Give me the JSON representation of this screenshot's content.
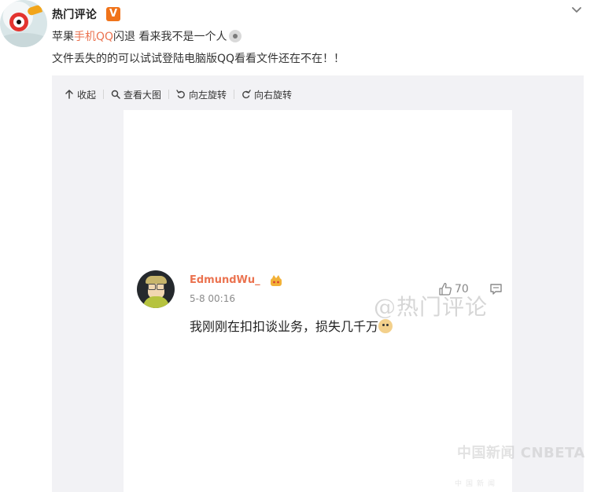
{
  "post": {
    "author": "热门评论",
    "verified_badge": "V",
    "line1_prefix": "苹果",
    "line1_highlight": "手机QQ",
    "line1_suffix": "闪退 看来我不是一个人",
    "line2": "文件丢失的的可以试试登陆电脑版QQ看看文件还在不在！！"
  },
  "toolbar": {
    "collapse": "收起",
    "view_large": "查看大图",
    "rotate_left": "向左旋转",
    "rotate_right": "向右旋转"
  },
  "comment": {
    "username": "EdmundWu_",
    "time": "5-8 00:16",
    "text": "我刚刚在扣扣谈业务，损失几千万",
    "likes": "70"
  },
  "watermark": "@热门评论",
  "brand": {
    "main": "中国新闻 CNBETA",
    "sub": "中国新闻"
  },
  "colors": {
    "accent": "#eb7350",
    "verified": "#f0731a",
    "panel_bg": "#f2f2f5"
  },
  "icons": {
    "collapse": "up-arrow-icon",
    "view_large": "search-icon",
    "rotate_left": "rotate-left-icon",
    "rotate_right": "rotate-right-icon",
    "like": "thumb-up-icon",
    "reply": "comment-icon",
    "chevron": "chevron-down-icon"
  }
}
